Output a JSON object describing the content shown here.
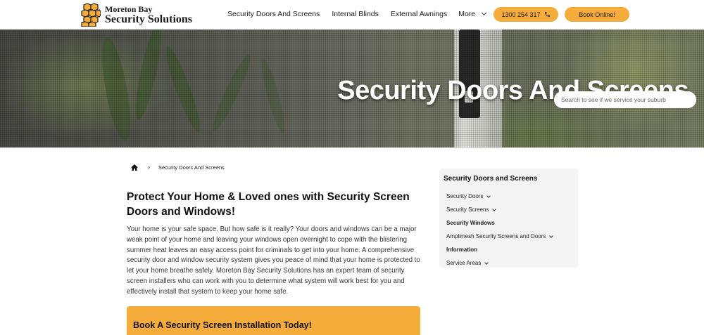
{
  "header": {
    "logo": {
      "line1": "Moreton Bay",
      "line2": "Security Solutions"
    },
    "nav": [
      {
        "label": "Security Doors And Screens"
      },
      {
        "label": "Internal Blinds"
      },
      {
        "label": "External Awnings"
      },
      {
        "label": "More"
      }
    ],
    "phone_button": "1300 254 317",
    "book_button": "Book Online!",
    "accent_color": "#f5ac3b"
  },
  "hero": {
    "title": "Security Doors And Screens",
    "search_placeholder": "Search to see if we service your suburb"
  },
  "breadcrumb": {
    "home_icon": "home-icon",
    "separator": "›",
    "current": "Security Doors And Screens"
  },
  "main": {
    "heading": "Protect Your Home & Loved ones with Security Screen Doors and Windows!",
    "paragraph": "Your home is your safe space. But how safe is it really? Your doors and windows can be a major weak point of your home and leaving your windows open overnight to cope with the blistering summer heat leaves an easy access point for criminals to get into your home. A comprehensive security door and window security system gives you peace of mind that your home is protected to let your home breathe safely. Moreton Bay Security Solutions has an expert team of security screen installers who can work with you to determine what system will work best for you and effectively install that system to keep your home safe.",
    "cta_title": "Book A Security Screen Installation Today!"
  },
  "sidebar": {
    "title": "Security Doors and Screens",
    "items": [
      {
        "label": "Security Doors",
        "has_dropdown": true
      },
      {
        "label": "Security Screens",
        "has_dropdown": true
      },
      {
        "label": "Security Windows",
        "has_dropdown": false
      },
      {
        "label": "Amplimesh Security Screens and Doors",
        "has_dropdown": true
      },
      {
        "label": "Information",
        "has_dropdown": false
      },
      {
        "label": "Service Areas",
        "has_dropdown": true
      }
    ]
  }
}
